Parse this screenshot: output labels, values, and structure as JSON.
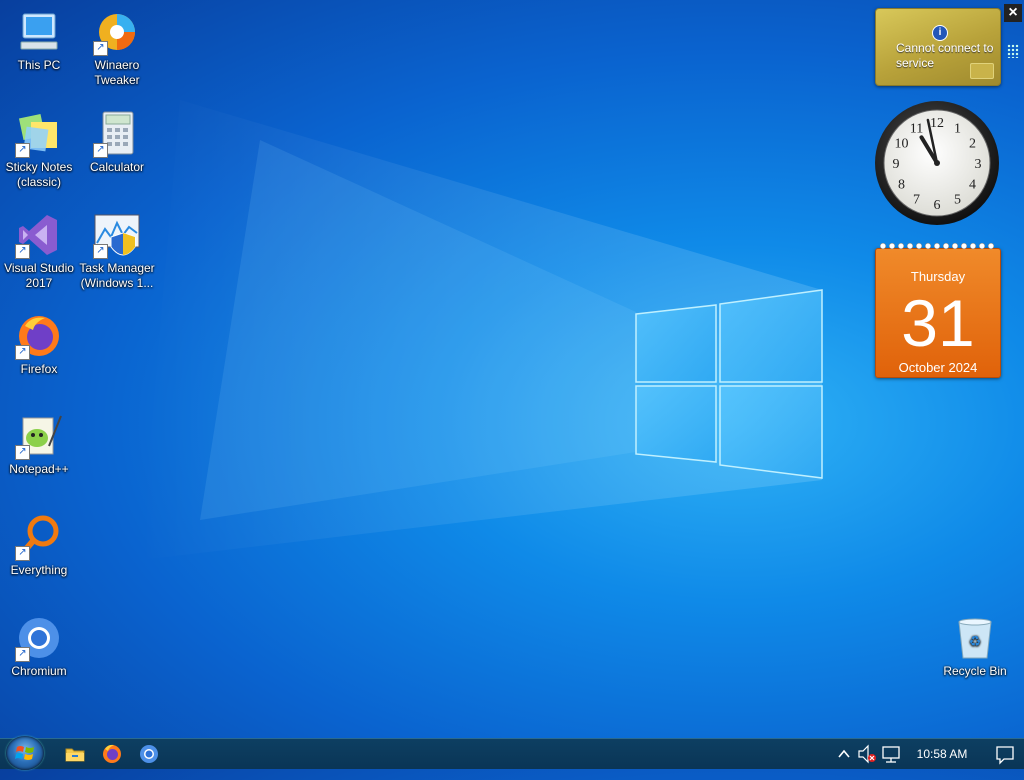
{
  "desktop": {
    "icons": [
      {
        "label": "This PC",
        "icon": "computer-icon"
      },
      {
        "label": "Winaero Tweaker",
        "icon": "winaero-icon"
      },
      {
        "label": "Sticky Notes (classic)",
        "icon": "sticky-notes-icon"
      },
      {
        "label": "Calculator",
        "icon": "calculator-icon"
      },
      {
        "label": "Visual Studio 2017",
        "icon": "visual-studio-icon"
      },
      {
        "label": "Task Manager (Windows 1...",
        "icon": "task-manager-icon"
      },
      {
        "label": "Firefox",
        "icon": "firefox-icon"
      },
      {
        "label": "Notepad++",
        "icon": "notepad-plus-plus-icon"
      },
      {
        "label": "Everything",
        "icon": "everything-search-icon"
      },
      {
        "label": "Chromium",
        "icon": "chromium-icon"
      },
      {
        "label": "Recycle Bin",
        "icon": "recycle-bin-icon"
      }
    ]
  },
  "gadgets": {
    "weather": {
      "message": "Cannot connect to service",
      "icon": "info-icon"
    },
    "clock": {
      "hours": [
        12,
        1,
        2,
        3,
        4,
        5,
        6,
        7,
        8,
        9,
        10,
        11
      ],
      "time": "10:58"
    },
    "calendar": {
      "weekday": "Thursday",
      "day": "31",
      "month_year": "October 2024",
      "color": "#e8700f"
    }
  },
  "taskbar": {
    "pinned": [
      "file-explorer-icon",
      "firefox-icon",
      "chromium-icon"
    ],
    "clock": "10:58 AM",
    "tray_icons": [
      "show-hidden-icons-chevron",
      "volume-muted-icon",
      "network-icon",
      "action-center-icon"
    ]
  },
  "colors": {
    "desktop_accent": "#0f8ae8",
    "taskbar": "#0a3556"
  }
}
